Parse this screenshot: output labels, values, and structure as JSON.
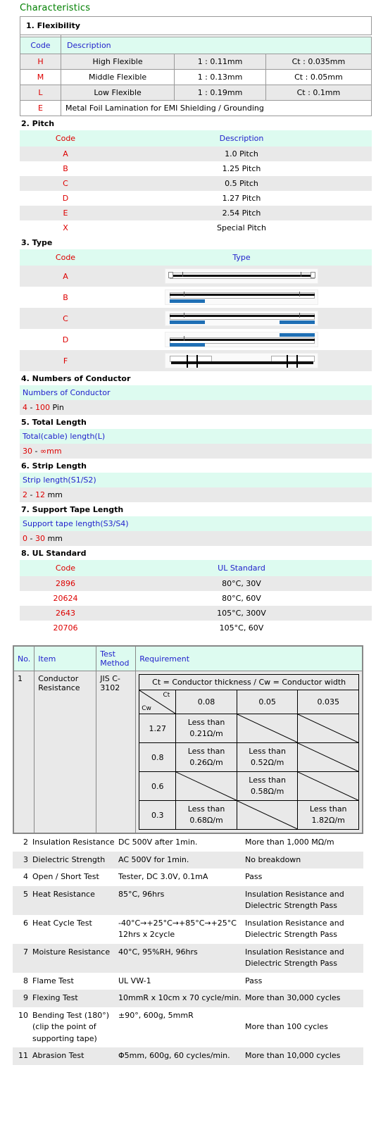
{
  "doc": {
    "title": "Characteristics"
  },
  "flexibility": {
    "heading": "1. Flexibility",
    "columns": {
      "code": "Code",
      "description": "Description"
    },
    "rows": [
      {
        "code": "H",
        "desc": "High Flexible",
        "ratio": "1 : 0.11mm",
        "ct": "Ct : 0.035mm"
      },
      {
        "code": "M",
        "desc": "Middle Flexible",
        "ratio": "1 : 0.13mm",
        "ct": "Ct : 0.05mm"
      },
      {
        "code": "L",
        "desc": "Low Flexible",
        "ratio": "1 : 0.19mm",
        "ct": "Ct : 0.1mm"
      }
    ],
    "full_row": {
      "code": "E",
      "desc": "Metal Foil Lamination for EMI Shielding / Grounding"
    }
  },
  "pitch": {
    "heading": "2. Pitch",
    "columns": {
      "code": "Code",
      "description": "Description"
    },
    "rows": [
      {
        "code": "A",
        "desc": "1.0 Pitch"
      },
      {
        "code": "B",
        "desc": "1.25 Pitch"
      },
      {
        "code": "C",
        "desc": "0.5 Pitch"
      },
      {
        "code": "D",
        "desc": "1.27 Pitch"
      },
      {
        "code": "E",
        "desc": "2.54 Pitch"
      },
      {
        "code": "X",
        "desc": "Special Pitch"
      }
    ]
  },
  "type": {
    "heading": "3. Type",
    "columns": {
      "code": "Code",
      "type": "Type"
    },
    "rows": [
      {
        "code": "A",
        "diagram": "cable-plain-both-ends"
      },
      {
        "code": "B",
        "diagram": "cable-tape-left"
      },
      {
        "code": "C",
        "diagram": "cable-tape-both-same-side"
      },
      {
        "code": "D",
        "diagram": "cable-tape-opposite-sides"
      },
      {
        "code": "F",
        "diagram": "cable-with-clips"
      }
    ]
  },
  "conductors": {
    "heading": "4. Numbers of Conductor",
    "label": "Numbers of Conductor",
    "min": "4",
    "sep": " - ",
    "max": "100",
    "unit": " Pin"
  },
  "total_length": {
    "heading": "5. Total Length",
    "label": "Total(cable) length(L)",
    "min": "30",
    "sep": " - ",
    "max": "∞",
    "unit": "mm"
  },
  "strip_length": {
    "heading": "6. Strip Length",
    "label": "Strip length(S1/S2)",
    "min": "2",
    "sep": " - ",
    "max": "12",
    "unit": " mm"
  },
  "support_tape": {
    "heading": "7. Support Tape Length",
    "label": "Support tape length(S3/S4)",
    "min": "0",
    "sep": " - ",
    "max": "30",
    "unit": " mm"
  },
  "ul": {
    "heading": "8. UL Standard",
    "columns": {
      "code": "Code",
      "standard": "UL Standard"
    },
    "rows": [
      {
        "code": "2896",
        "standard": "80°C, 30V"
      },
      {
        "code": "20624",
        "standard": "80°C, 60V"
      },
      {
        "code": "2643",
        "standard": "105°C, 300V"
      },
      {
        "code": "20706",
        "standard": "105°C, 60V"
      }
    ]
  },
  "tests": {
    "columns": {
      "no": "No.",
      "item": "Item",
      "method": "Test Method",
      "requirement": "Requirement"
    },
    "conductor_resistance": {
      "no": "1",
      "item": "Conductor Resistance",
      "method": "JIS C-3102",
      "matrix": {
        "caption": "Ct = Conductor thickness / Cw = Conductor width",
        "row_label": "Cw",
        "col_label": "Ct",
        "columns": [
          "0.08",
          "0.05",
          "0.035"
        ],
        "rows": [
          {
            "cw": "1.27",
            "cells": [
              "Less than 0.21Ω/m",
              "",
              ""
            ]
          },
          {
            "cw": "0.8",
            "cells": [
              "Less than 0.26Ω/m",
              "Less than 0.52Ω/m",
              ""
            ]
          },
          {
            "cw": "0.6",
            "cells": [
              "",
              "Less than 0.58Ω/m",
              ""
            ]
          },
          {
            "cw": "0.3",
            "cells": [
              "Less than 0.68Ω/m",
              "",
              "Less than 1.82Ω/m"
            ]
          }
        ]
      }
    },
    "rows": [
      {
        "no": "2",
        "item": "Insulation Resistance",
        "method": "DC 500V after 1min.",
        "requirement": "More than 1,000 MΩ/m"
      },
      {
        "no": "3",
        "item": "Dielectric Strength",
        "method": "AC 500V for 1min.",
        "requirement": "No breakdown"
      },
      {
        "no": "4",
        "item": "Open / Short Test",
        "method": "Tester, DC 3.0V, 0.1mA",
        "requirement": "Pass"
      },
      {
        "no": "5",
        "item": "Heat Resistance",
        "method": "85°C, 96hrs",
        "requirement": "Insulation Resistance and Dielectric Strength Pass"
      },
      {
        "no": "6",
        "item": "Heat Cycle Test",
        "method": "-40°C→+25°C→+85°C→+25°C 12hrs x 2cycle",
        "requirement": "Insulation Resistance and Dielectric Strength Pass"
      },
      {
        "no": "7",
        "item": "Moisture Resistance",
        "method": "40°C, 95%RH, 96hrs",
        "requirement": "Insulation Resistance and Dielectric Strength Pass"
      },
      {
        "no": "8",
        "item": "Flame Test",
        "method": "UL VW-1",
        "requirement": "Pass"
      },
      {
        "no": "9",
        "item": "Flexing Test",
        "method": "10mmR x 10cm x 70 cycle/min.",
        "requirement": "More than 30,000 cycles"
      },
      {
        "no": "10",
        "item": "Bending Test (180°) (clip the point of supporting tape)",
        "method": "±90°, 600g, 5mmR",
        "requirement": "More than 100 cycles"
      },
      {
        "no": "11",
        "item": "Abrasion Test",
        "method": "Φ5mm, 600g, 60 cycles/min.",
        "requirement": "More than 10,000 cycles"
      }
    ]
  },
  "colors": {
    "title_green": "#008000",
    "header_cyan": "#ddfbf0",
    "header_blue": "#2222cc",
    "code_red": "#dd0000",
    "row_gray": "#e9e9e9",
    "tape_blue": "#1f6fb5"
  }
}
